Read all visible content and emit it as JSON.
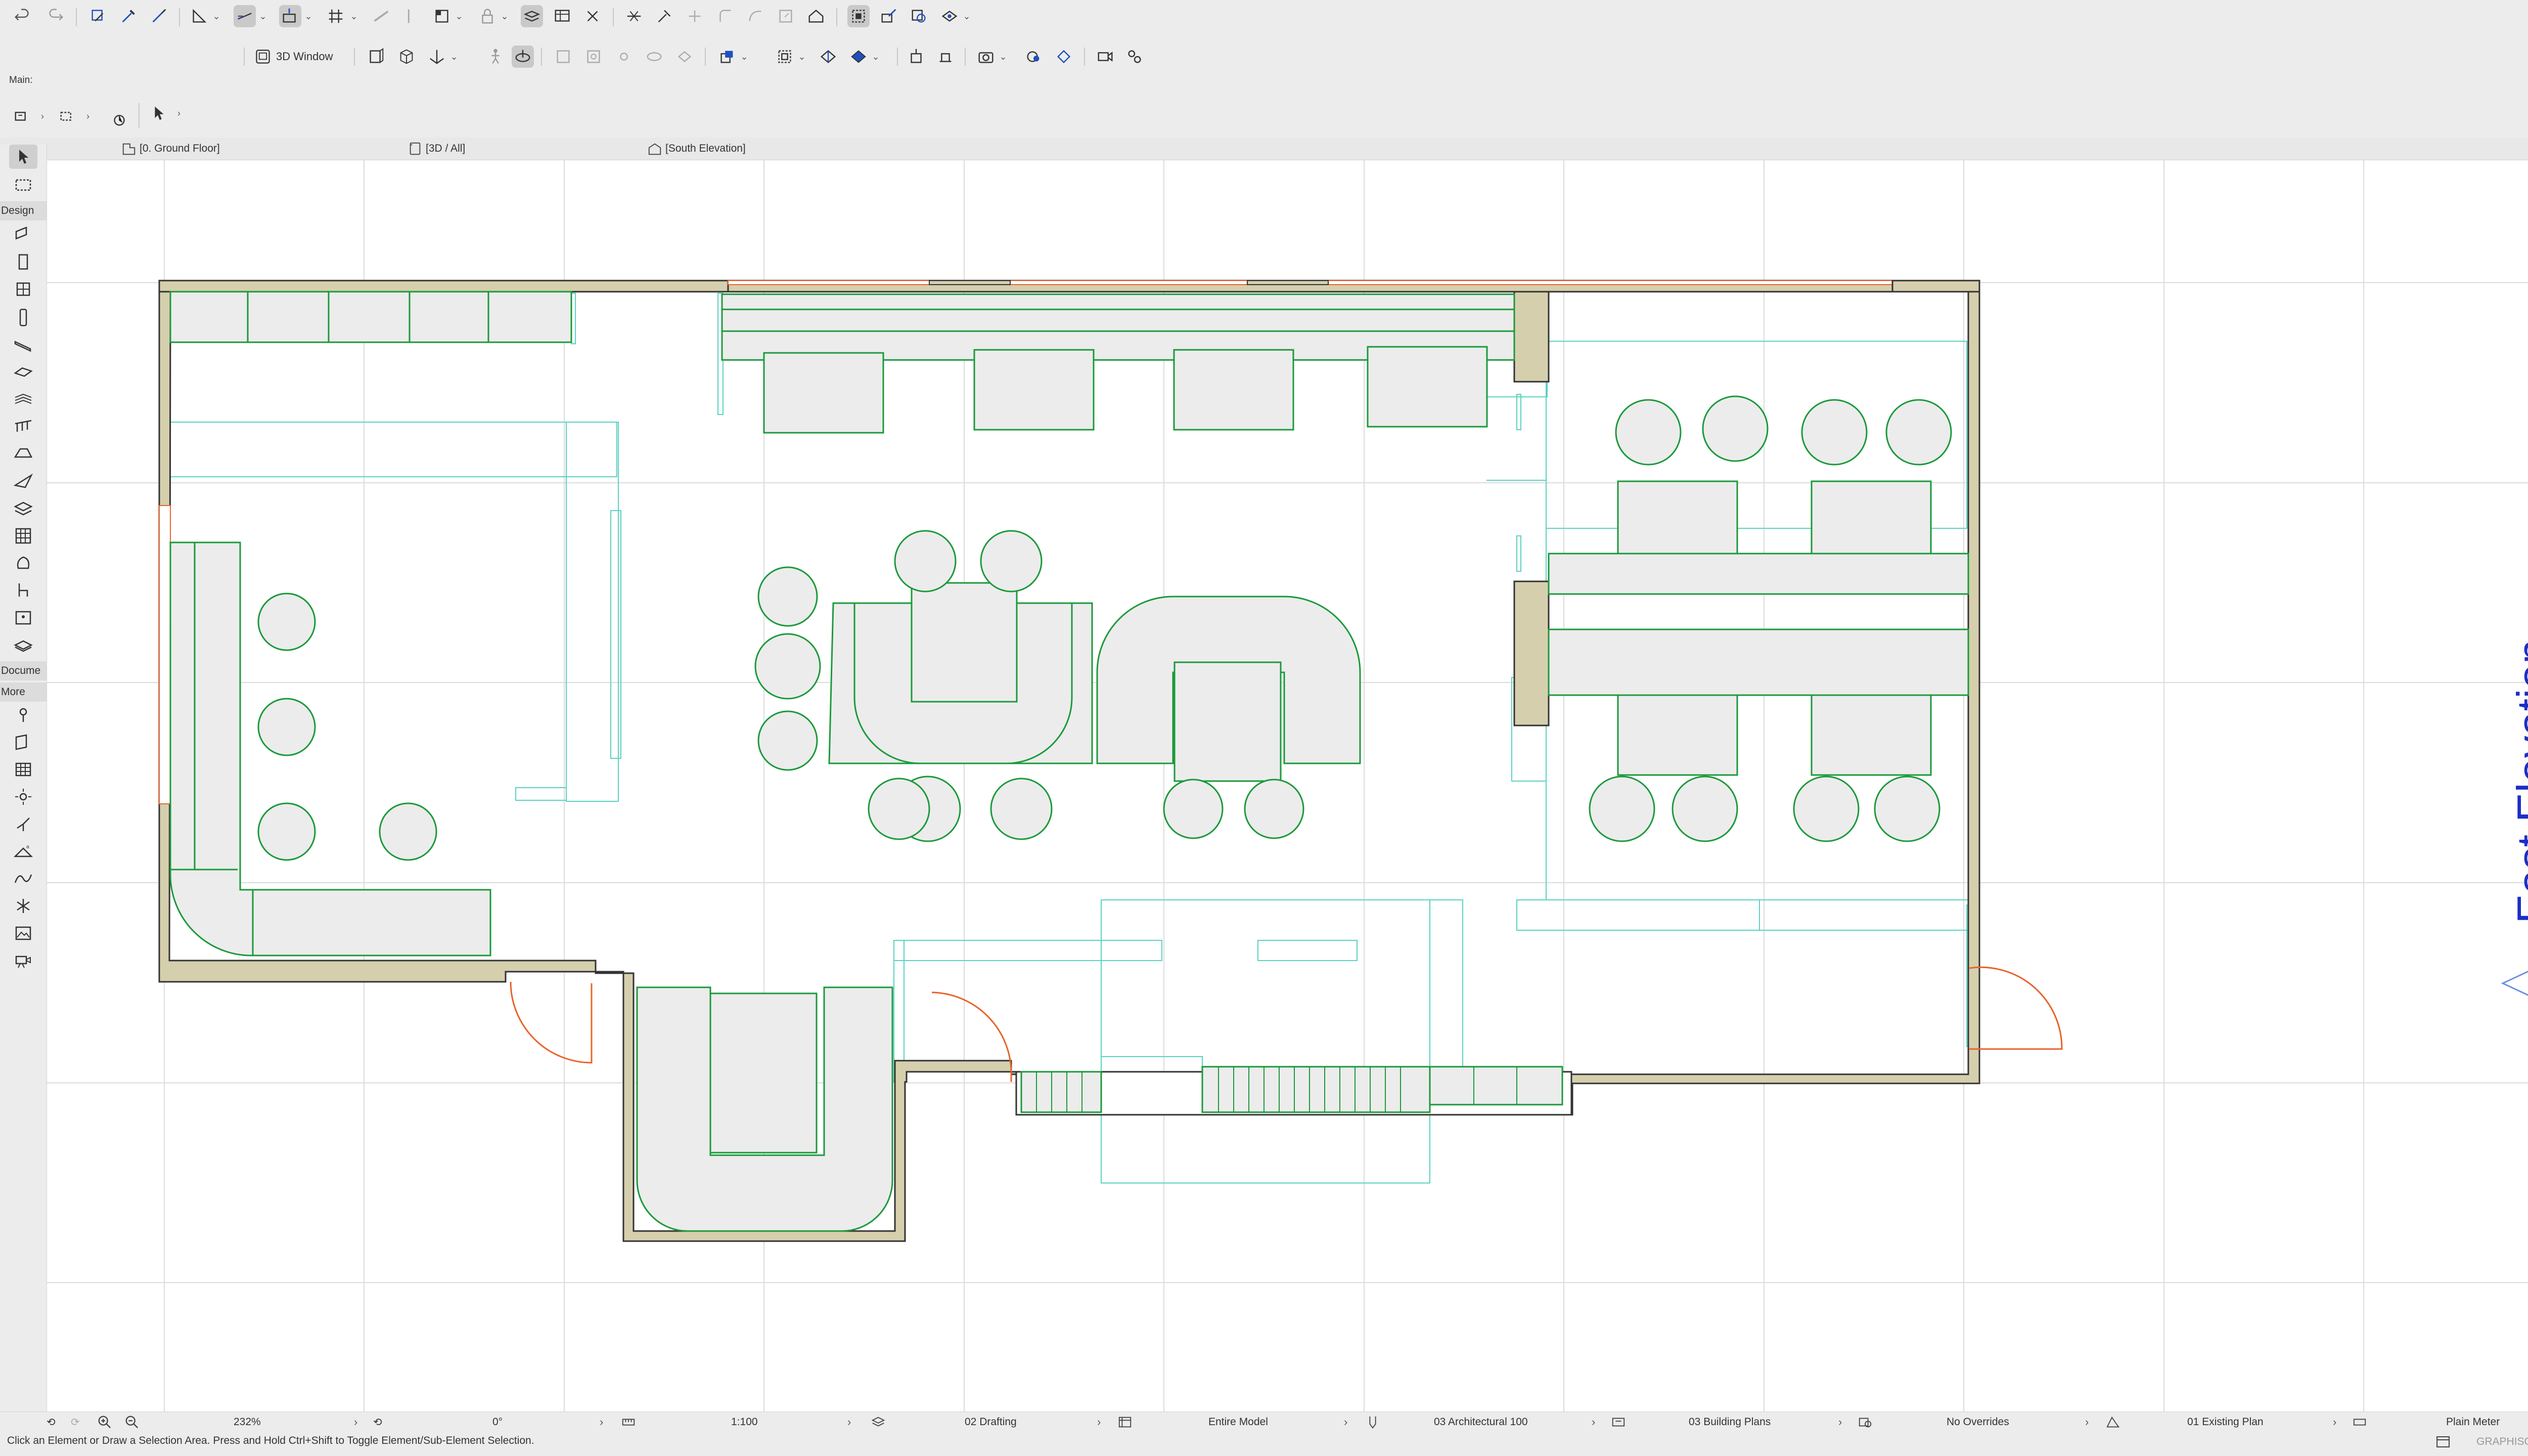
{
  "toolbar": {
    "view_window_label": "3D Window"
  },
  "info_box": {
    "label": "Main:"
  },
  "tabs": [
    {
      "label": "[0. Ground Floor]",
      "icon": "floor-plan-icon"
    },
    {
      "label": "[3D / All]",
      "icon": "3d-view-icon"
    },
    {
      "label": "[South Elevation]",
      "icon": "elevation-icon"
    }
  ],
  "toolbox": {
    "design_header": "Design",
    "document_header": "Docume",
    "more_header": "More"
  },
  "canvas": {
    "elevation_marker_label": "East Elevation",
    "colors": {
      "wall_fill": "#d6cfae",
      "wall_stroke": "#333333",
      "furniture_stroke": "#1a9a3a",
      "furniture_fill": "#ececec",
      "aux_stroke": "#5ad1c1",
      "door_stroke": "#e8642a",
      "marker_color": "#1c2ec8",
      "grid": "#dcdcdc"
    }
  },
  "statusbar": {
    "zoom": "232%",
    "angle": "0°",
    "scale": "1:100",
    "layer_combination": "02 Drafting",
    "model_view": "Entire Model",
    "pen_set": "03 Architectural 100",
    "mvo": "03 Building Plans",
    "graphic_override": "No Overrides",
    "renovation": "01 Existing Plan",
    "dimension": "Plain Meter"
  },
  "message": {
    "hint": "Click an Element or Draw a Selection Area. Press and Hold Ctrl+Shift to Toggle Element/Sub-Element Selection.",
    "brand": "GRAPHISOFT ©"
  }
}
